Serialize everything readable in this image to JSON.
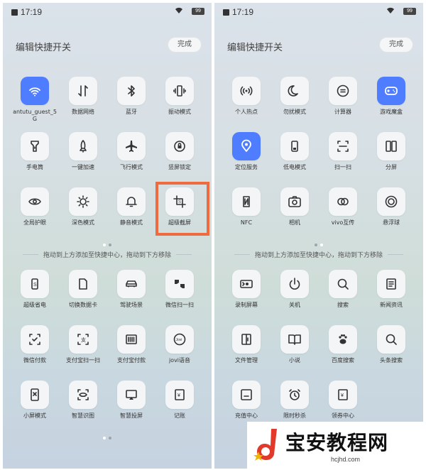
{
  "status": {
    "time": "17:19",
    "battery": "99"
  },
  "header": {
    "title": "编辑快捷开关",
    "done_label": "完成"
  },
  "colors": {
    "accent": "#4f7dff",
    "highlight": "#ef6a3f"
  },
  "left": {
    "active": [
      {
        "label": "antutu_guest_5G",
        "icon": "wifi-icon",
        "on": true
      },
      {
        "label": "数据网络",
        "icon": "data-network-icon"
      },
      {
        "label": "蓝牙",
        "icon": "bluetooth-icon"
      },
      {
        "label": "振动模式",
        "icon": "vibrate-icon"
      },
      {
        "label": "手电筒",
        "icon": "flashlight-icon"
      },
      {
        "label": "一键加速",
        "icon": "rocket-icon"
      },
      {
        "label": "飞行模式",
        "icon": "airplane-icon"
      },
      {
        "label": "竖屏锁定",
        "icon": "rotation-lock-icon"
      },
      {
        "label": "全局护眼",
        "icon": "eye-icon"
      },
      {
        "label": "深色模式",
        "icon": "dark-mode-icon"
      },
      {
        "label": "静音模式",
        "icon": "bell-icon"
      },
      {
        "label": "超级截屏",
        "icon": "screenshot-icon"
      }
    ],
    "more": [
      {
        "label": "超级省电",
        "icon": "power-saving-icon"
      },
      {
        "label": "切换数据卡",
        "icon": "sim-card-icon"
      },
      {
        "label": "驾驶场景",
        "icon": "car-icon"
      },
      {
        "label": "微信扫一扫",
        "icon": "wechat-scan-icon"
      },
      {
        "label": "微信付款",
        "icon": "wechat-pay-icon"
      },
      {
        "label": "支付宝扫一扫",
        "icon": "alipay-scan-icon"
      },
      {
        "label": "支付宝付款",
        "icon": "barcode-icon"
      },
      {
        "label": "jovi语音",
        "icon": "jovi-icon"
      },
      {
        "label": "小屏模式",
        "icon": "small-screen-icon"
      },
      {
        "label": "智慧识图",
        "icon": "smart-recognition-icon"
      },
      {
        "label": "智慧投屏",
        "icon": "screen-cast-icon"
      },
      {
        "label": "记账",
        "icon": "bookkeeping-icon"
      }
    ]
  },
  "right": {
    "active": [
      {
        "label": "个人热点",
        "icon": "hotspot-icon"
      },
      {
        "label": "勿扰模式",
        "icon": "moon-icon"
      },
      {
        "label": "计算器",
        "icon": "calculator-icon"
      },
      {
        "label": "游戏魔盒",
        "icon": "gamepad-icon",
        "on": true
      },
      {
        "label": "定位服务",
        "icon": "location-icon",
        "on": true
      },
      {
        "label": "低电模式",
        "icon": "battery-icon"
      },
      {
        "label": "扫一扫",
        "icon": "scan-icon"
      },
      {
        "label": "分屏",
        "icon": "split-screen-icon"
      },
      {
        "label": "NFC",
        "icon": "nfc-icon"
      },
      {
        "label": "相机",
        "icon": "camera-icon"
      },
      {
        "label": "vivo互传",
        "icon": "vivo-share-icon"
      },
      {
        "label": "悬浮球",
        "icon": "floating-ball-icon"
      }
    ],
    "more": [
      {
        "label": "录制屏幕",
        "icon": "screen-record-icon"
      },
      {
        "label": "关机",
        "icon": "power-icon"
      },
      {
        "label": "搜索",
        "icon": "search-icon"
      },
      {
        "label": "新闻资讯",
        "icon": "news-icon"
      },
      {
        "label": "文件管理",
        "icon": "file-manager-icon"
      },
      {
        "label": "小说",
        "icon": "book-icon"
      },
      {
        "label": "百度搜索",
        "icon": "baidu-icon"
      },
      {
        "label": "头条搜索",
        "icon": "search-icon"
      },
      {
        "label": "充值中心",
        "icon": "recharge-icon"
      },
      {
        "label": "限时秒杀",
        "icon": "alarm-clock-icon"
      },
      {
        "label": "领券中心",
        "icon": "coupon-icon"
      }
    ]
  },
  "divider_text": "拖动到上方添加至快捷中心，拖动到下方移除",
  "watermark": {
    "text": "宝安教程网",
    "url": "hcjhd.com"
  }
}
